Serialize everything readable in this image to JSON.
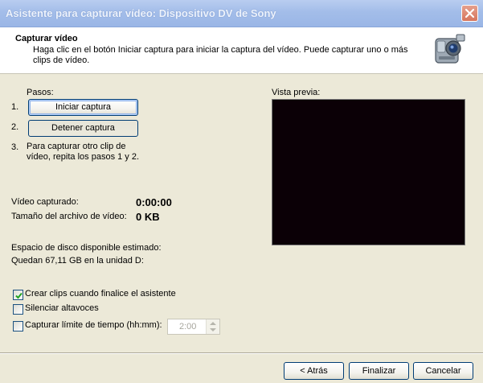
{
  "window": {
    "title": "Asistente para capturar vídeo: Dispositivo DV de Sony"
  },
  "header": {
    "title": "Capturar vídeo",
    "description": "Haga clic en el botón Iniciar captura para iniciar la captura del vídeo. Puede capturar uno o más clips de vídeo."
  },
  "steps": {
    "label": "Pasos:",
    "step1_number": "1.",
    "step1_button": "Iniciar captura",
    "step2_number": "2.",
    "step2_button": "Detener captura",
    "step3_number": "3.",
    "step3_text": "Para capturar otro clip de vídeo, repita los pasos 1 y 2."
  },
  "stats": {
    "captured_label": "Vídeo capturado:",
    "captured_value": "0:00:00",
    "filesize_label": "Tamaño del archivo de vídeo:",
    "filesize_value": "0 KB"
  },
  "disk": {
    "label": "Espacio de disco disponible estimado:",
    "value": "Quedan 67,11 GB en la unidad D:"
  },
  "options": {
    "create_clips": {
      "label": "Crear clips cuando finalice el asistente",
      "checked": true
    },
    "mute": {
      "label": "Silenciar altavoces",
      "checked": false
    },
    "time_limit": {
      "label": "Capturar límite de tiempo (hh:mm):",
      "checked": false,
      "value": "2:00"
    }
  },
  "preview": {
    "label": "Vista previa:",
    "background": "#0b0006"
  },
  "footer": {
    "back": "< Atrás",
    "finish": "Finalizar",
    "cancel": "Cancelar"
  },
  "icons": {
    "close": "close-icon",
    "camera": "camcorder-icon",
    "check": "checkmark-icon"
  }
}
